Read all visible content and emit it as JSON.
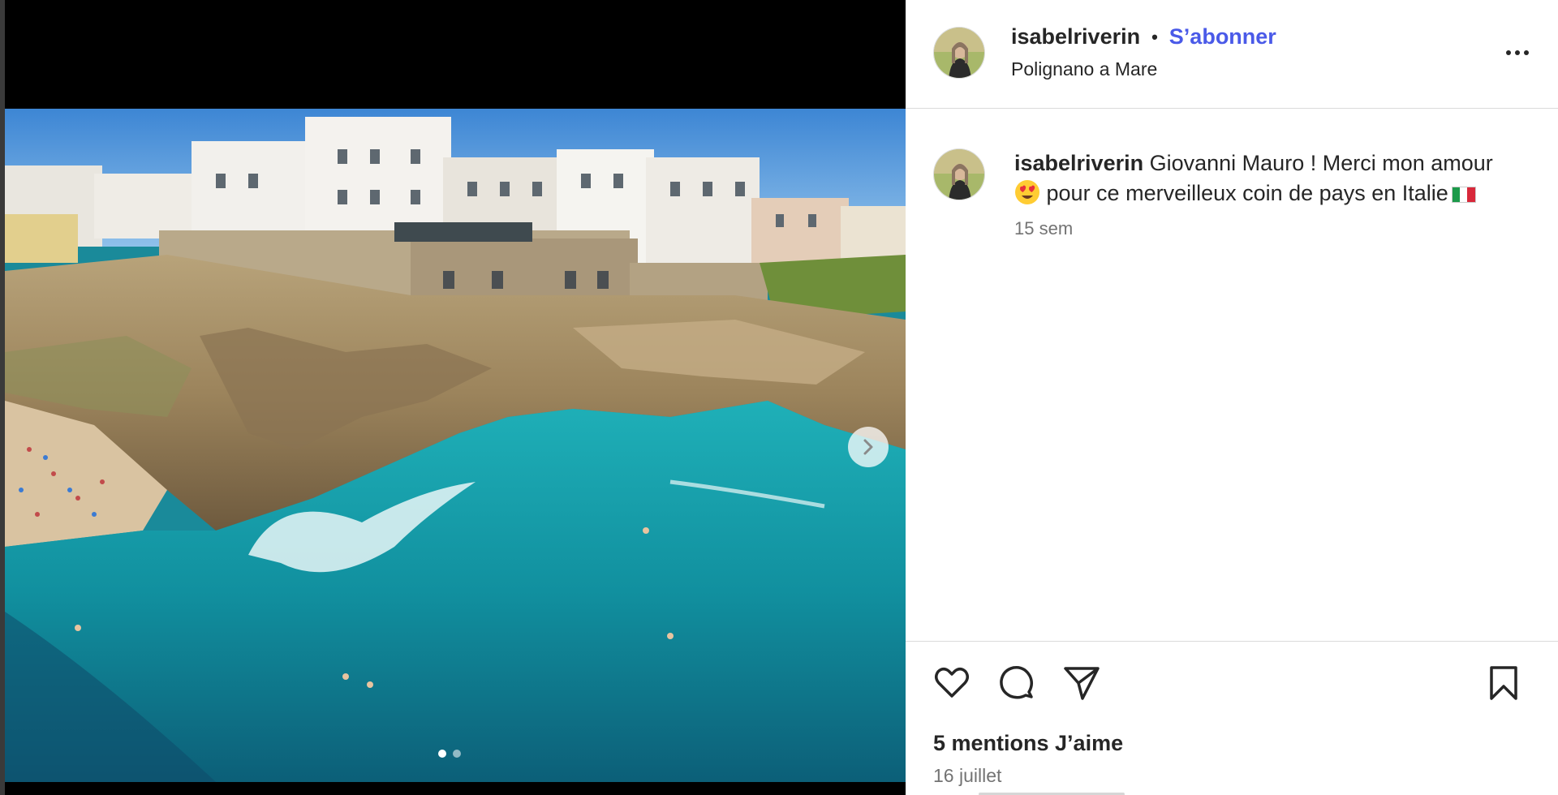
{
  "post": {
    "username": "isabelriverin",
    "separator": "•",
    "follow_label": "S’abonner",
    "location": "Polignano a Mare"
  },
  "caption": {
    "username": "isabelriverin",
    "text_part1": "Giovanni Mauro ! Merci mon amour",
    "emoji": "heart-eyes-emoji",
    "text_part2": "pour ce merveilleux coin de pays en Italie",
    "flag": "italy-flag",
    "time_ago": "15 sem"
  },
  "footer": {
    "likes": "5 mentions J’aime",
    "date": "16 juillet"
  },
  "carousel": {
    "slide_count": 2,
    "current_slide": 1
  },
  "colors": {
    "follow": "#4a5ae8",
    "sea": "#1a8a9a",
    "sky": "#4f93d6"
  }
}
